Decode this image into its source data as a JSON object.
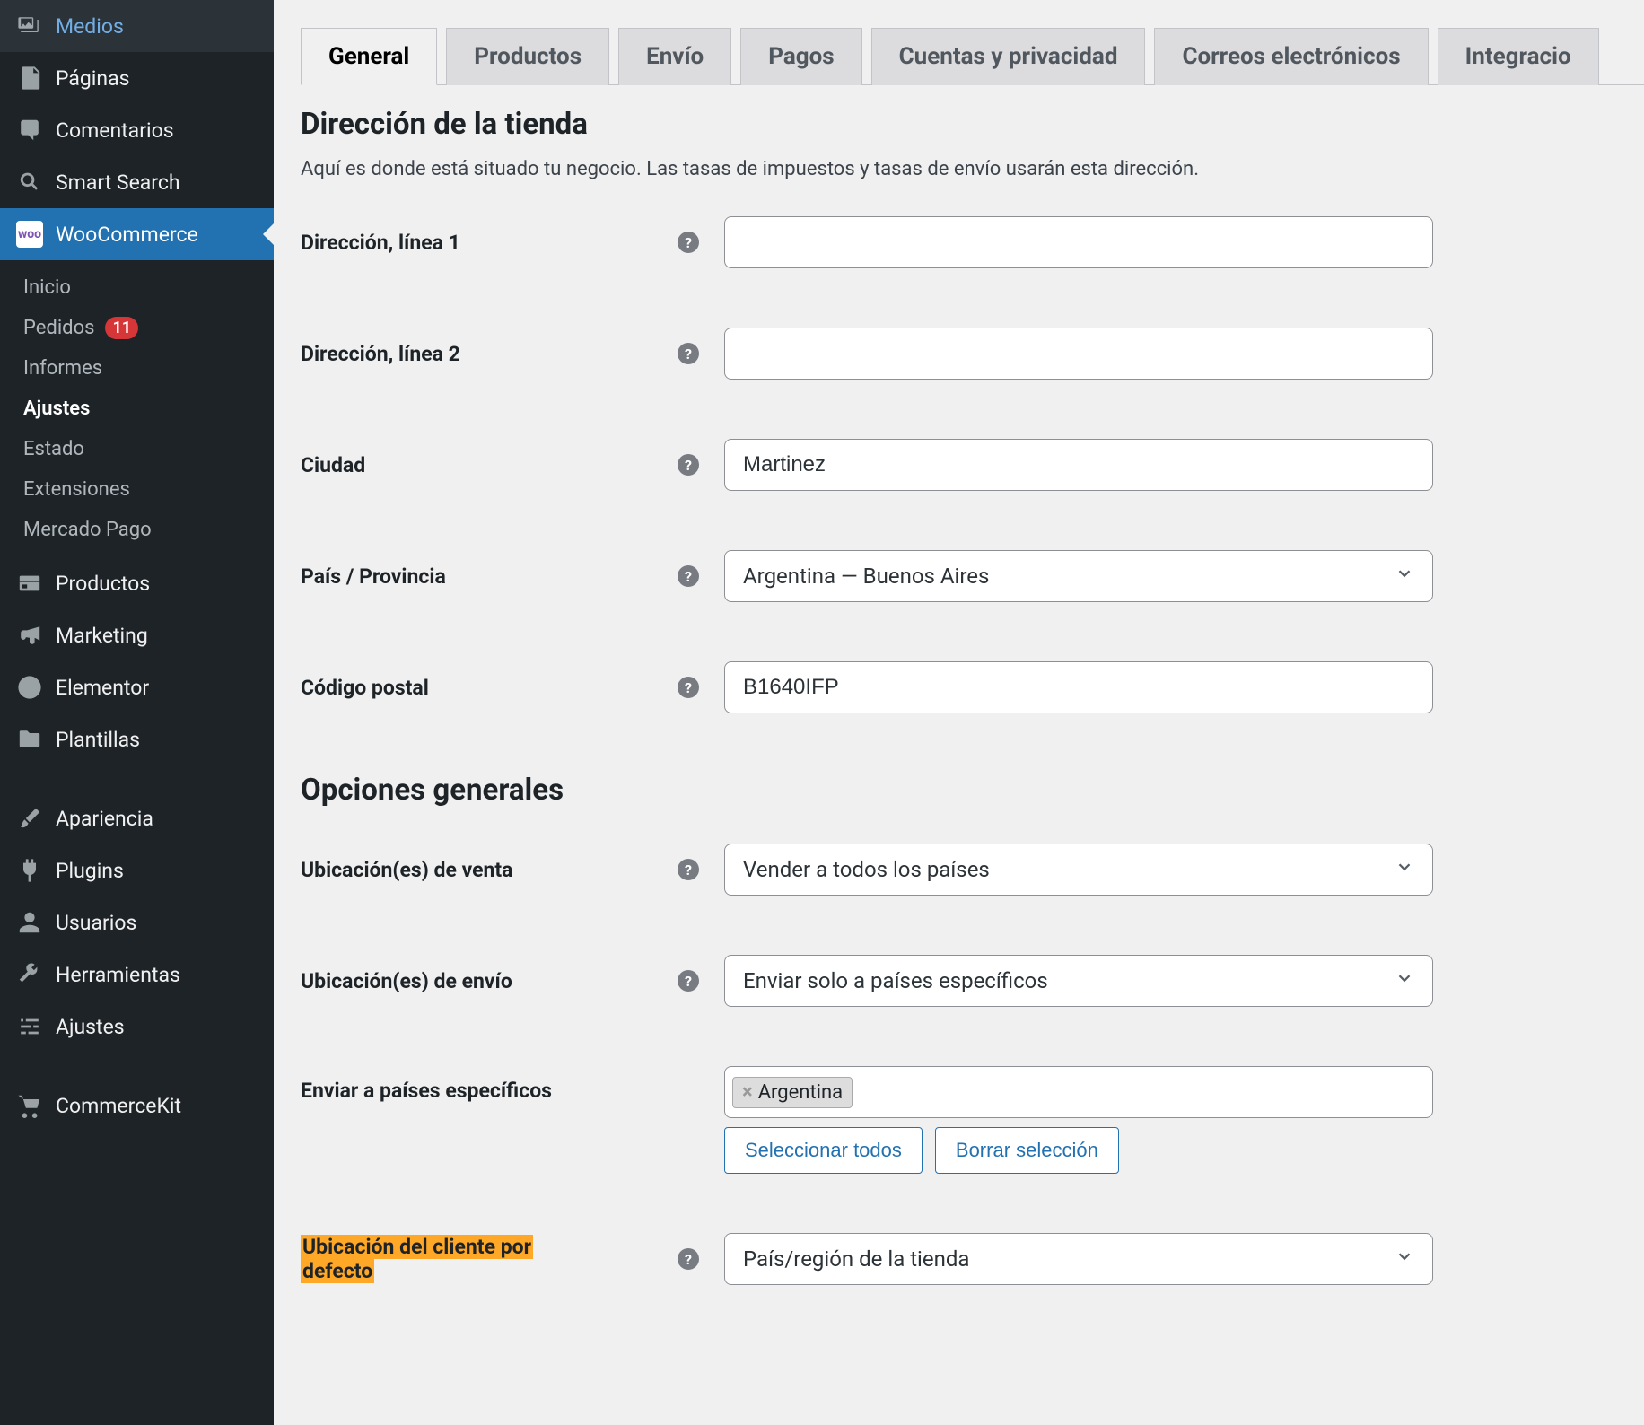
{
  "sidebar": {
    "items": [
      {
        "label": "Medios"
      },
      {
        "label": "Páginas"
      },
      {
        "label": "Comentarios"
      },
      {
        "label": "Smart Search"
      },
      {
        "label": "WooCommerce"
      },
      {
        "label": "Productos"
      },
      {
        "label": "Marketing"
      },
      {
        "label": "Elementor"
      },
      {
        "label": "Plantillas"
      },
      {
        "label": "Apariencia"
      },
      {
        "label": "Plugins"
      },
      {
        "label": "Usuarios"
      },
      {
        "label": "Herramientas"
      },
      {
        "label": "Ajustes"
      },
      {
        "label": "CommerceKit"
      }
    ],
    "submenu": [
      {
        "label": "Inicio"
      },
      {
        "label": "Pedidos",
        "badge": "11"
      },
      {
        "label": "Informes"
      },
      {
        "label": "Ajustes"
      },
      {
        "label": "Estado"
      },
      {
        "label": "Extensiones"
      },
      {
        "label": "Mercado Pago"
      }
    ]
  },
  "tabs": [
    {
      "label": "General"
    },
    {
      "label": "Productos"
    },
    {
      "label": "Envío"
    },
    {
      "label": "Pagos"
    },
    {
      "label": "Cuentas y privacidad"
    },
    {
      "label": "Correos electrónicos"
    },
    {
      "label": "Integracio"
    }
  ],
  "section_address": {
    "title": "Dirección de la tienda",
    "desc": "Aquí es donde está situado tu negocio. Las tasas de impuestos y tasas de envío usarán esta dirección.",
    "addr1_label": "Dirección, línea 1",
    "addr1_value": "",
    "addr2_label": "Dirección, línea 2",
    "addr2_value": "",
    "city_label": "Ciudad",
    "city_value": "Martinez",
    "country_label": "País / Provincia",
    "country_value": "Argentina — Buenos Aires",
    "postal_label": "Código postal",
    "postal_value": "B1640IFP"
  },
  "section_general": {
    "title": "Opciones generales",
    "sell_loc_label": "Ubicación(es) de venta",
    "sell_loc_value": "Vender a todos los países",
    "ship_loc_label": "Ubicación(es) de envío",
    "ship_loc_value": "Enviar solo a países específicos",
    "ship_specific_label": "Enviar a países específicos",
    "ship_chip": "Argentina",
    "select_all": "Seleccionar todos",
    "clear_all": "Borrar selección",
    "default_loc_label_1": "Ubicación del cliente por",
    "default_loc_label_2": "defecto",
    "default_loc_value": "País/región de la tienda"
  }
}
